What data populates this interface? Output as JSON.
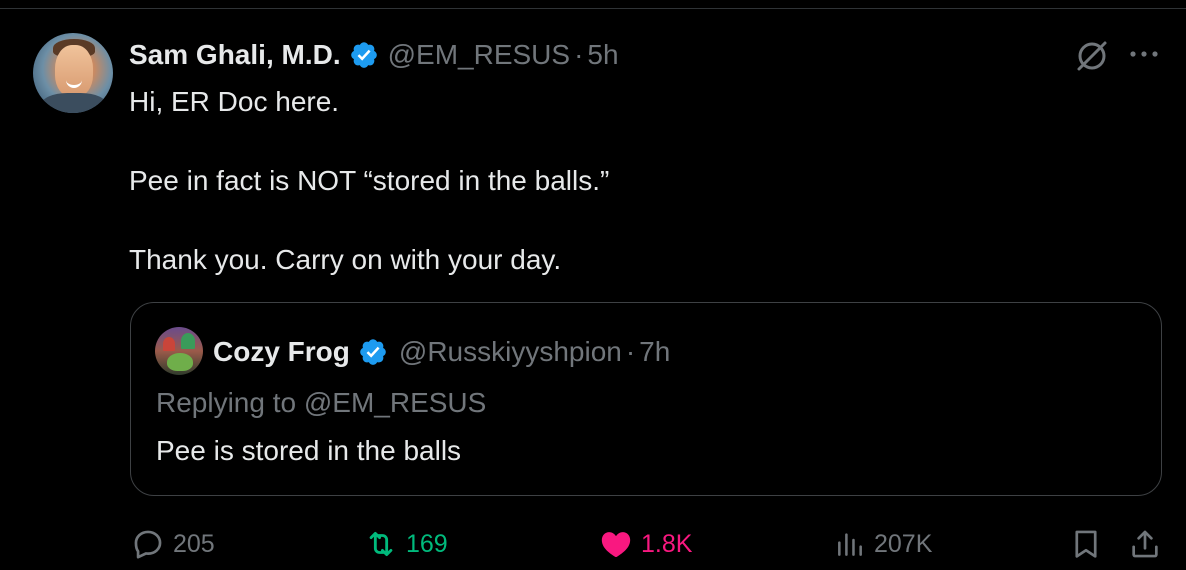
{
  "tweet": {
    "author": {
      "name": "Sam Ghali, M.D.",
      "handle": "@EM_RESUS",
      "separator": "·",
      "time": "5h",
      "verified": true
    },
    "text_lines": [
      "Hi, ER Doc here.",
      "Pee in fact is NOT “stored in the balls.”",
      "Thank you. Carry on with your day."
    ],
    "header_icons": [
      "grok-icon",
      "more-icon"
    ]
  },
  "quoted_tweet": {
    "author": {
      "name": "Cozy Frog",
      "handle": "@Russkiyyshpion",
      "separator": "·",
      "time": "7h",
      "verified": true
    },
    "replying_to": "Replying to @EM_RESUS",
    "text": "Pee is stored in the balls"
  },
  "actions": {
    "replies": "205",
    "retweets": "169",
    "likes": "1.8K",
    "views": "207K",
    "icons": [
      "reply-icon",
      "retweet-icon",
      "heart-icon",
      "views-icon",
      "bookmark-icon",
      "share-icon"
    ]
  },
  "colors": {
    "background": "#000000",
    "text_primary": "#e7e9ea",
    "text_secondary": "#71767b",
    "verified_blue": "#1d9bf0",
    "retweet_green": "#00ba7c",
    "like_pink": "#f91880",
    "border": "#3e4144"
  }
}
